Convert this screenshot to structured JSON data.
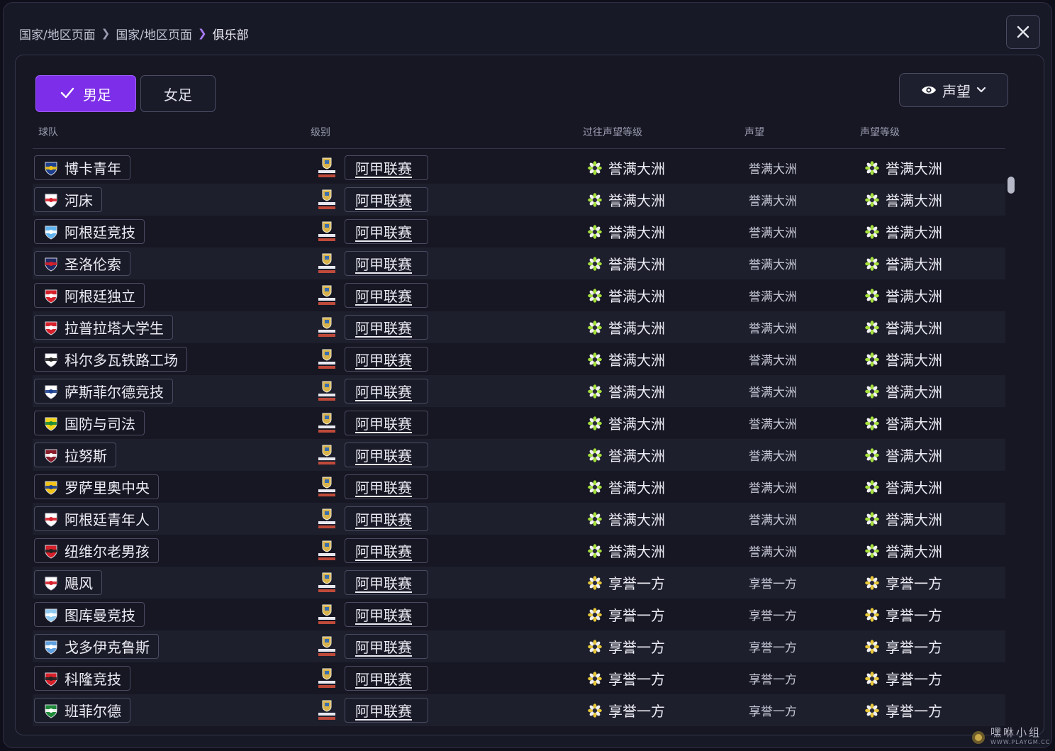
{
  "breadcrumb": {
    "items": [
      "国家/地区页面",
      "国家/地区页面"
    ],
    "current": "俱乐部"
  },
  "gender_tabs": [
    {
      "label": "男足",
      "active": true
    },
    {
      "label": "女足",
      "active": false
    }
  ],
  "reputation_dropdown": {
    "label": "声望",
    "icon": "eye-icon"
  },
  "columns": {
    "team": "球队",
    "division": "级别",
    "past_reputation": "过往声望等级",
    "reputation": "声望",
    "reputation_level": "声望等级"
  },
  "colors": {
    "accent": "#7d2ee8",
    "continental": "#a6e13c",
    "regional": "#e8c83a"
  },
  "rows": [
    {
      "team": "博卡青年",
      "crest_color": "#1c3f8f",
      "crest_accent": "#f3c316",
      "league": "阿甲联赛",
      "past": "誉满大洲",
      "rep": "誉满大洲",
      "level": "誉满大洲",
      "tier": "continental"
    },
    {
      "team": "河床",
      "crest_color": "#ffffff",
      "crest_accent": "#d6202a",
      "league": "阿甲联赛",
      "past": "誉满大洲",
      "rep": "誉满大洲",
      "level": "誉满大洲",
      "tier": "continental"
    },
    {
      "team": "阿根廷竞技",
      "crest_color": "#5fb4f0",
      "crest_accent": "#ffffff",
      "league": "阿甲联赛",
      "past": "誉满大洲",
      "rep": "誉满大洲",
      "level": "誉满大洲",
      "tier": "continental"
    },
    {
      "team": "圣洛伦索",
      "crest_color": "#1f2a66",
      "crest_accent": "#d6202a",
      "league": "阿甲联赛",
      "past": "誉满大洲",
      "rep": "誉满大洲",
      "level": "誉满大洲",
      "tier": "continental"
    },
    {
      "team": "阿根廷独立",
      "crest_color": "#d6202a",
      "crest_accent": "#ffffff",
      "league": "阿甲联赛",
      "past": "誉满大洲",
      "rep": "誉满大洲",
      "level": "誉满大洲",
      "tier": "continental"
    },
    {
      "team": "拉普拉塔大学生",
      "crest_color": "#d6202a",
      "crest_accent": "#ffffff",
      "league": "阿甲联赛",
      "past": "誉满大洲",
      "rep": "誉满大洲",
      "level": "誉满大洲",
      "tier": "continental"
    },
    {
      "team": "科尔多瓦铁路工场",
      "crest_color": "#ffffff",
      "crest_accent": "#222222",
      "league": "阿甲联赛",
      "past": "誉满大洲",
      "rep": "誉满大洲",
      "level": "誉满大洲",
      "tier": "continental"
    },
    {
      "team": "萨斯菲尔德竞技",
      "crest_color": "#ffffff",
      "crest_accent": "#1c3f8f",
      "league": "阿甲联赛",
      "past": "誉满大洲",
      "rep": "誉满大洲",
      "level": "誉满大洲",
      "tier": "continental"
    },
    {
      "team": "国防与司法",
      "crest_color": "#f3d416",
      "crest_accent": "#1e8a3a",
      "league": "阿甲联赛",
      "past": "誉满大洲",
      "rep": "誉满大洲",
      "level": "誉满大洲",
      "tier": "continental"
    },
    {
      "team": "拉努斯",
      "crest_color": "#8a1c2a",
      "crest_accent": "#ffffff",
      "league": "阿甲联赛",
      "past": "誉满大洲",
      "rep": "誉满大洲",
      "level": "誉满大洲",
      "tier": "continental"
    },
    {
      "team": "罗萨里奥中央",
      "crest_color": "#f3c316",
      "crest_accent": "#1c3f8f",
      "league": "阿甲联赛",
      "past": "誉满大洲",
      "rep": "誉满大洲",
      "level": "誉满大洲",
      "tier": "continental"
    },
    {
      "team": "阿根廷青年人",
      "crest_color": "#ffffff",
      "crest_accent": "#d6202a",
      "league": "阿甲联赛",
      "past": "誉满大洲",
      "rep": "誉满大洲",
      "level": "誉满大洲",
      "tier": "continental"
    },
    {
      "team": "纽维尔老男孩",
      "crest_color": "#d6202a",
      "crest_accent": "#222222",
      "league": "阿甲联赛",
      "past": "誉满大洲",
      "rep": "誉满大洲",
      "level": "誉满大洲",
      "tier": "continental"
    },
    {
      "team": "飓风",
      "crest_color": "#ffffff",
      "crest_accent": "#d6202a",
      "league": "阿甲联赛",
      "past": "享誉一方",
      "rep": "享誉一方",
      "level": "享誉一方",
      "tier": "regional"
    },
    {
      "team": "图库曼竞技",
      "crest_color": "#8fc9f0",
      "crest_accent": "#ffffff",
      "league": "阿甲联赛",
      "past": "享誉一方",
      "rep": "享誉一方",
      "level": "享誉一方",
      "tier": "regional"
    },
    {
      "team": "戈多伊克鲁斯",
      "crest_color": "#5fa0e0",
      "crest_accent": "#ffffff",
      "league": "阿甲联赛",
      "past": "享誉一方",
      "rep": "享誉一方",
      "level": "享誉一方",
      "tier": "regional"
    },
    {
      "team": "科隆竞技",
      "crest_color": "#d6202a",
      "crest_accent": "#222222",
      "league": "阿甲联赛",
      "past": "享誉一方",
      "rep": "享誉一方",
      "level": "享誉一方",
      "tier": "regional"
    },
    {
      "team": "班菲尔德",
      "crest_color": "#1e8a3a",
      "crest_accent": "#ffffff",
      "league": "阿甲联赛",
      "past": "享誉一方",
      "rep": "享誉一方",
      "level": "享誉一方",
      "tier": "regional"
    }
  ],
  "watermark": {
    "main": "嘿咻小组",
    "url": "WWW.PLAYGM.CC"
  }
}
